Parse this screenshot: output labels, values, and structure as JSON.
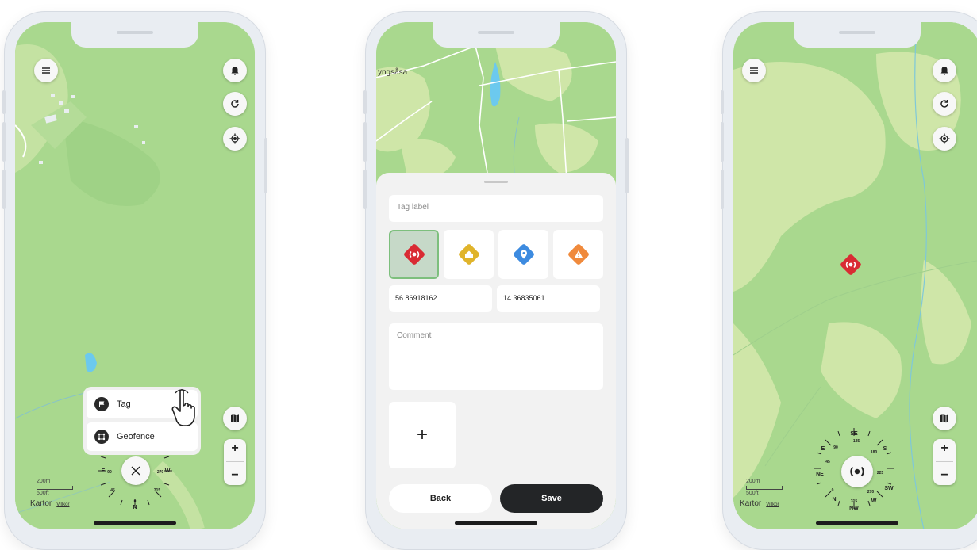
{
  "phone1": {
    "menu": {
      "tag_label": "Tag",
      "geofence_label": "Geofence"
    },
    "compass": {
      "center_icon": "close-icon",
      "labels": [
        "N",
        "NE",
        "E",
        "SE",
        "S",
        "SW",
        "W",
        "NW",
        "0",
        "45",
        "90",
        "135",
        "180",
        "225",
        "270",
        "315"
      ]
    },
    "scale": {
      "top": "200m",
      "bottom": "500ft"
    },
    "attribution": {
      "logo": "Kartor",
      "link": "Villkor"
    }
  },
  "phone2": {
    "map_label": "yngsåsa",
    "form": {
      "tag_label_placeholder": "Tag label",
      "icons": [
        "signal-icon",
        "home-icon",
        "pin-icon",
        "warning-icon"
      ],
      "icon_colors": [
        "#d92b33",
        "#e0b42b",
        "#3d8be0",
        "#f08a3c"
      ],
      "latitude": "56.86918162",
      "longitude": "14.36835061",
      "comment_placeholder": "Comment",
      "add_symbol": "+",
      "back_label": "Back",
      "save_label": "Save"
    }
  },
  "phone3": {
    "marker_color": "#d92b33",
    "scale": {
      "top": "200m",
      "bottom": "500ft"
    },
    "attribution": {
      "logo": "Kartor",
      "link": "Villkor"
    }
  },
  "colors": {
    "map_green": "#a9d88e",
    "map_light": "#cfe6a8",
    "water": "#6cc9ee",
    "accent_dark": "#2a2a2a"
  }
}
